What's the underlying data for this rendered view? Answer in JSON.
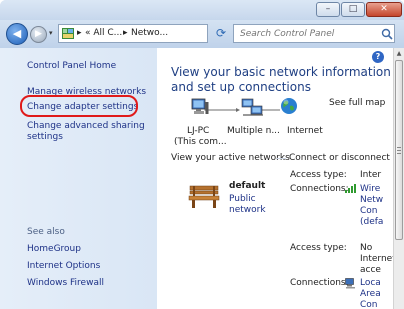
{
  "window": {
    "controls": {
      "minimize": "–",
      "maximize": "□",
      "close": "✕"
    }
  },
  "address": {
    "crumbs": [
      "« All C...",
      "Netwo..."
    ],
    "separators": [
      "▸",
      "▸"
    ],
    "dropdown": "▾"
  },
  "search": {
    "placeholder": "Search Control Panel"
  },
  "sidebar": {
    "home": "Control Panel Home",
    "items": [
      "Manage wireless networks",
      "Change adapter settings",
      "Change advanced sharing",
      "settings"
    ],
    "see_also_heading": "See also",
    "see_also": [
      "HomeGroup",
      "Internet Options",
      "Windows Firewall"
    ]
  },
  "main": {
    "title_line1": "View your basic network information",
    "title_line2": "and set up connections",
    "see_full_map": "See full map",
    "nodes": [
      {
        "label": "LJ-PC",
        "sub": "(This com..."
      },
      {
        "label": "Multiple n..."
      },
      {
        "label": "Internet"
      }
    ],
    "active_networks_label": "View your active networks",
    "connect_link": "Connect or disconnect",
    "network1": {
      "name": "default",
      "type_link_1": "Public",
      "type_link_2": "network",
      "access_label": "Access type:",
      "access_value": "Inter",
      "connections_label": "Connections:",
      "connections_lines": [
        "Wire",
        "Netw",
        "Con",
        "(defa"
      ]
    },
    "network2": {
      "access_label": "Access type:",
      "access_lines": [
        "No",
        "Internet",
        "acce"
      ],
      "connections_label": "Connections:",
      "connections_lines": [
        "Loca",
        "Area",
        "Con"
      ]
    }
  },
  "colors": {
    "highlight": "#e01a1a",
    "link": "#1e3287",
    "title": "#1f3f83"
  }
}
